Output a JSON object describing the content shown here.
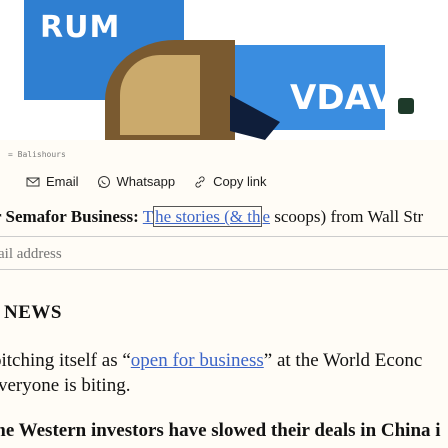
{
  "hero": {
    "text_left": "RUM",
    "text_right": "VDAV"
  },
  "credit": "= Balishours",
  "share": {
    "email_label": "Email",
    "whatsapp_label": "Whatsapp",
    "copy_label": "Copy link"
  },
  "intro": {
    "lead": "r Semafor Business:",
    "link_text_a": "T",
    "link_text_box": "he stories (& th",
    "link_text_b": "e",
    "rest": " scoops) from Wall Str"
  },
  "email_field": {
    "placeholder": "ail address"
  },
  "news_heading": "NEWS",
  "article": {
    "p1_before": "oitching itself as “",
    "p1_link": "open for business",
    "p1_after": "” at the World Econc",
    "p2": "veryone is biting.",
    "p3": "me Western investors have slowed their deals in China i"
  },
  "colors": {
    "link": "#3b64c8",
    "hero_blue": "#2f7fd1",
    "background": "#fffcf6"
  }
}
